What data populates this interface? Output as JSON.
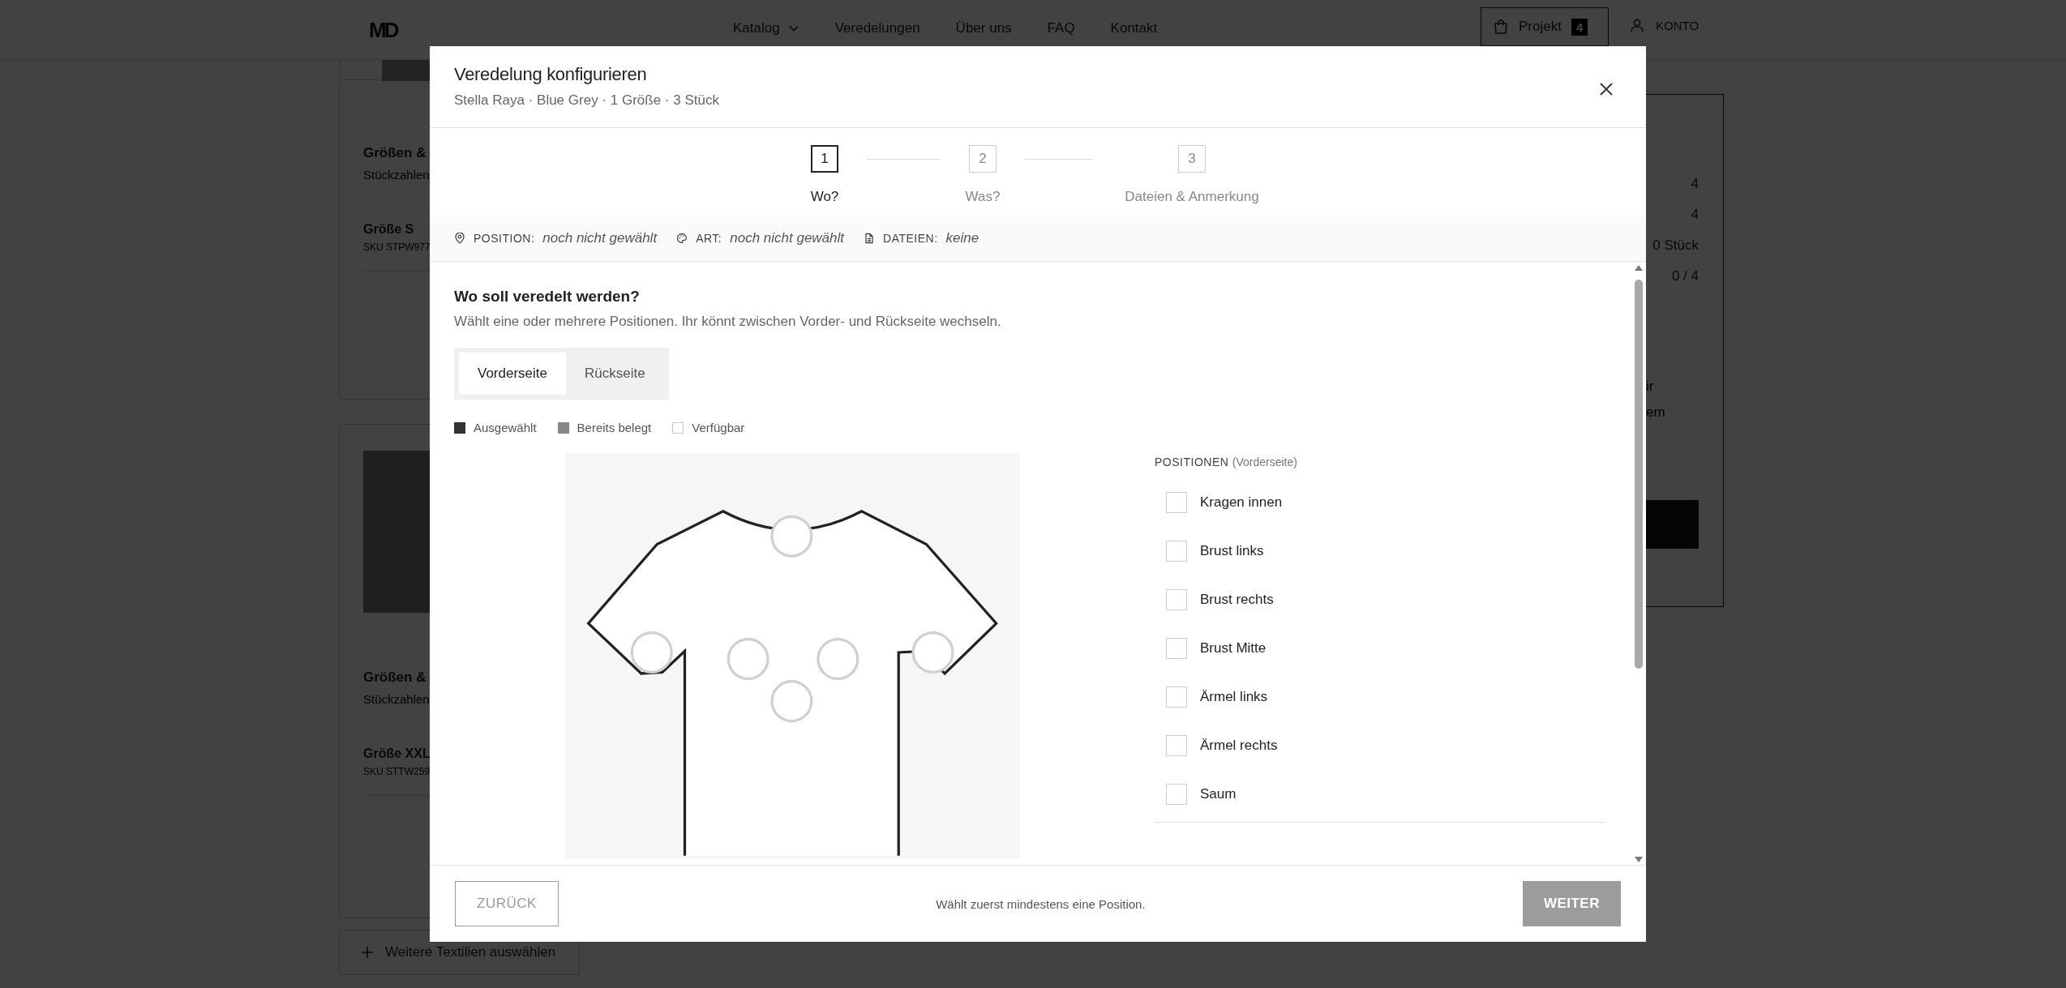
{
  "header": {
    "logo": "MD",
    "nav": [
      {
        "label": "Katalog",
        "has_menu": true
      },
      {
        "label": "Veredelungen",
        "has_menu": false
      },
      {
        "label": "Über uns",
        "has_menu": false
      },
      {
        "label": "FAQ",
        "has_menu": false
      },
      {
        "label": "Kontakt",
        "has_menu": false
      }
    ],
    "cart": {
      "label": "Projekt",
      "count": "4"
    },
    "account": "KONTO"
  },
  "background": {
    "cards": [
      {
        "heading": "Größen &",
        "subheading": "Stückzahlen",
        "size": "Größe S",
        "sku": "SKU STPW977"
      },
      {
        "heading": "Größen &",
        "subheading": "Stückzahlen",
        "size": "Größe XXL",
        "sku": "SKU STTW259"
      }
    ],
    "add_button": "Weitere Textilien auswählen",
    "summary_values": [
      "4",
      "4",
      "0 Stück",
      "0 / 4"
    ],
    "note_lines": [
      "ir",
      "em"
    ]
  },
  "modal": {
    "title": "Veredelung konfigurieren",
    "subtitle": "Stella Raya · Blue Grey · 1 Größe · 3 Stück",
    "steps": [
      {
        "number": "1",
        "label": "Wo?",
        "selected": true
      },
      {
        "number": "2",
        "label": "Was?",
        "selected": false
      },
      {
        "number": "3",
        "label": "Dateien & Anmerkung",
        "selected": false
      }
    ],
    "summary": [
      {
        "kind": "position",
        "label": "POSITION:",
        "value": "noch nicht gewählt"
      },
      {
        "kind": "art",
        "label": "ART:",
        "value": "noch nicht gewählt"
      },
      {
        "kind": "files",
        "label": "DATEIEN:",
        "value": "keine"
      }
    ],
    "question": "Wo soll veredelt werden?",
    "hint": "Wählt eine oder mehrere Positionen. Ihr könnt zwischen Vorder- und Rückseite wechseln.",
    "sides": [
      {
        "label": "Vorderseite",
        "selected": true
      },
      {
        "label": "Rückseite",
        "selected": false
      }
    ],
    "legend": [
      {
        "kind": "selected",
        "label": "Ausgewählt"
      },
      {
        "kind": "occupied",
        "label": "Bereits belegt"
      },
      {
        "kind": "available",
        "label": "Verfügbar"
      }
    ],
    "positions_heading": "POSITIONEN",
    "positions_side": "(Vorderseite)",
    "positions": [
      {
        "label": "Kragen innen",
        "checked": false
      },
      {
        "label": "Brust links",
        "checked": false
      },
      {
        "label": "Brust rechts",
        "checked": false
      },
      {
        "label": "Brust Mitte",
        "checked": false
      },
      {
        "label": "Ärmel links",
        "checked": false
      },
      {
        "label": "Ärmel rechts",
        "checked": false
      },
      {
        "label": "Saum",
        "checked": false
      }
    ],
    "footer": {
      "back": {
        "label": "ZURÜCK",
        "disabled": true
      },
      "message": "Wählt zuerst mindestens eine Position.",
      "next": {
        "label": "WEITER",
        "disabled": true
      }
    }
  }
}
